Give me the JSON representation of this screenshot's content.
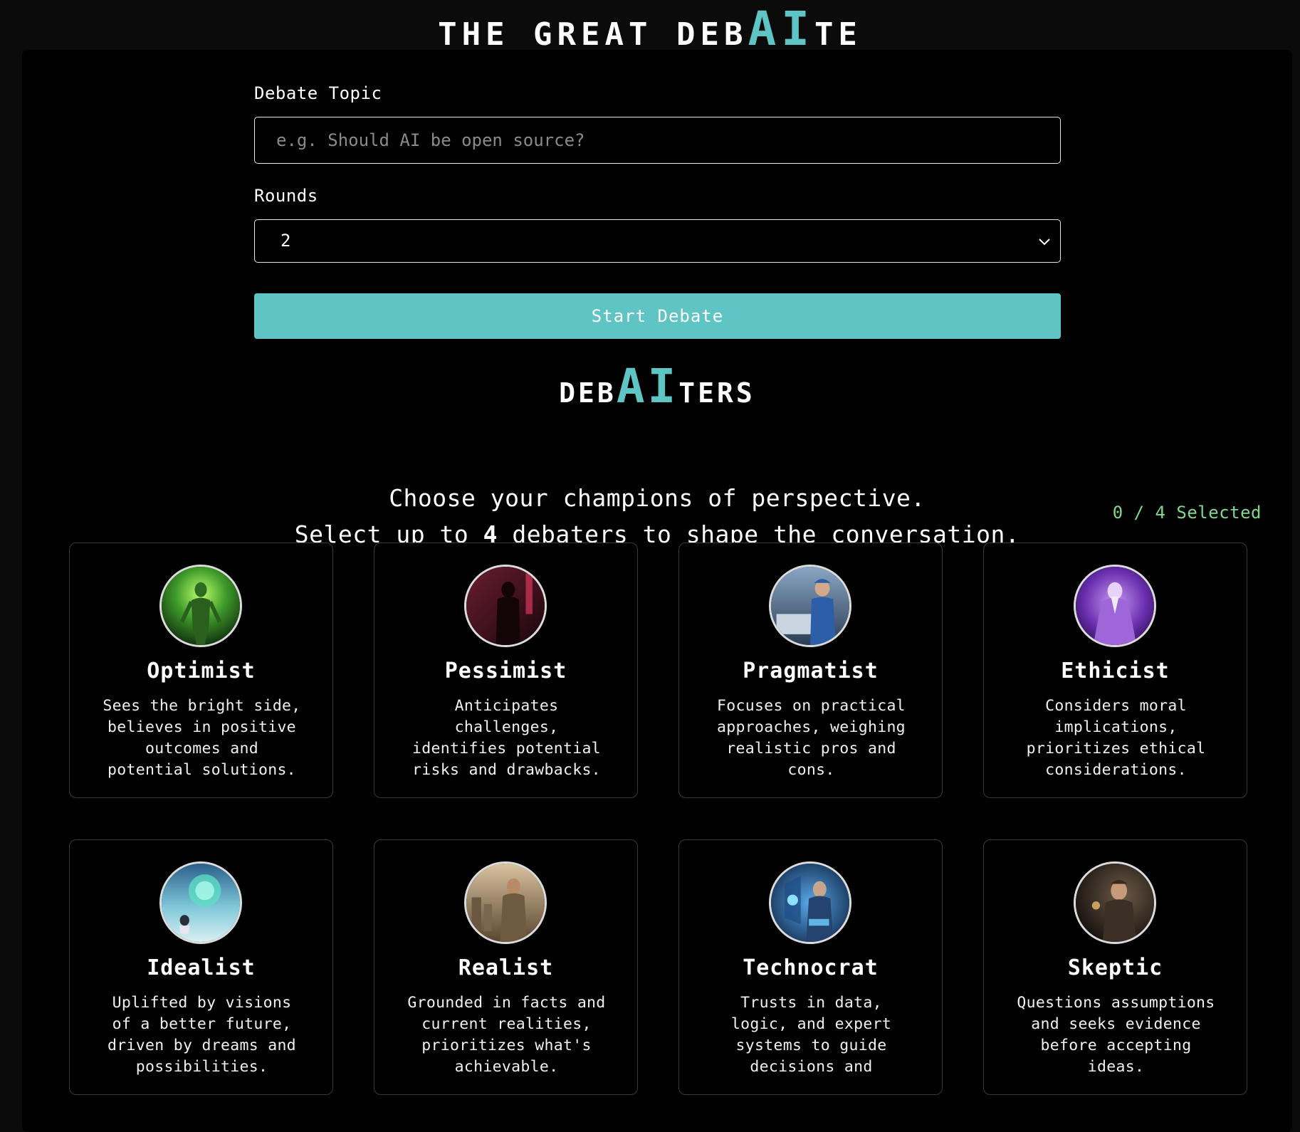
{
  "header": {
    "title_prefix": "THE GREAT DEB",
    "title_ai": "AI",
    "title_suffix": "TE"
  },
  "form": {
    "topic_label": "Debate Topic",
    "topic_placeholder": "e.g. Should AI be open source?",
    "topic_value": "",
    "rounds_label": "Rounds",
    "rounds_value": "2",
    "start_label": "Start Debate"
  },
  "debaters_section": {
    "title_prefix": "DEB",
    "title_ai": "AI",
    "title_suffix": "TERS",
    "subtitle_line1": "Choose your champions of perspective.",
    "subtitle_line2_pre": "Select up to ",
    "subtitle_line2_num": "4",
    "subtitle_line2_post": " debaters to shape the conversation.",
    "selected_count": "0 / 4 Selected"
  },
  "debaters": [
    {
      "name": "Optimist",
      "description": "Sees the bright side, believes in positive outcomes and potential solutions.",
      "avatar": "green-figure-avatar-icon"
    },
    {
      "name": "Pessimist",
      "description": "Anticipates challenges, identifies potential risks and drawbacks.",
      "avatar": "dark-red-figure-avatar-icon"
    },
    {
      "name": "Pragmatist",
      "description": "Focuses on practical approaches, weighing realistic pros and cons.",
      "avatar": "engineer-avatar-icon"
    },
    {
      "name": "Ethicist",
      "description": "Considers moral implications, prioritizes ethical considerations.",
      "avatar": "purple-sage-avatar-icon"
    },
    {
      "name": "Idealist",
      "description": "Uplifted by visions of a better future, driven by dreams and possibilities.",
      "avatar": "dreamer-avatar-icon"
    },
    {
      "name": "Realist",
      "description": "Grounded in facts and current realities, prioritizes what's achievable.",
      "avatar": "soldier-avatar-icon"
    },
    {
      "name": "Technocrat",
      "description": "Trusts in data, logic, and expert systems to guide decisions and",
      "avatar": "tech-operator-avatar-icon"
    },
    {
      "name": "Skeptic",
      "description": "Questions assumptions and seeks evidence before accepting ideas.",
      "avatar": "thinker-avatar-icon"
    }
  ],
  "colors": {
    "accent": "#5ec4c4",
    "count": "#7ed98a",
    "background": "#0b0b0b",
    "panel": "#000000"
  }
}
